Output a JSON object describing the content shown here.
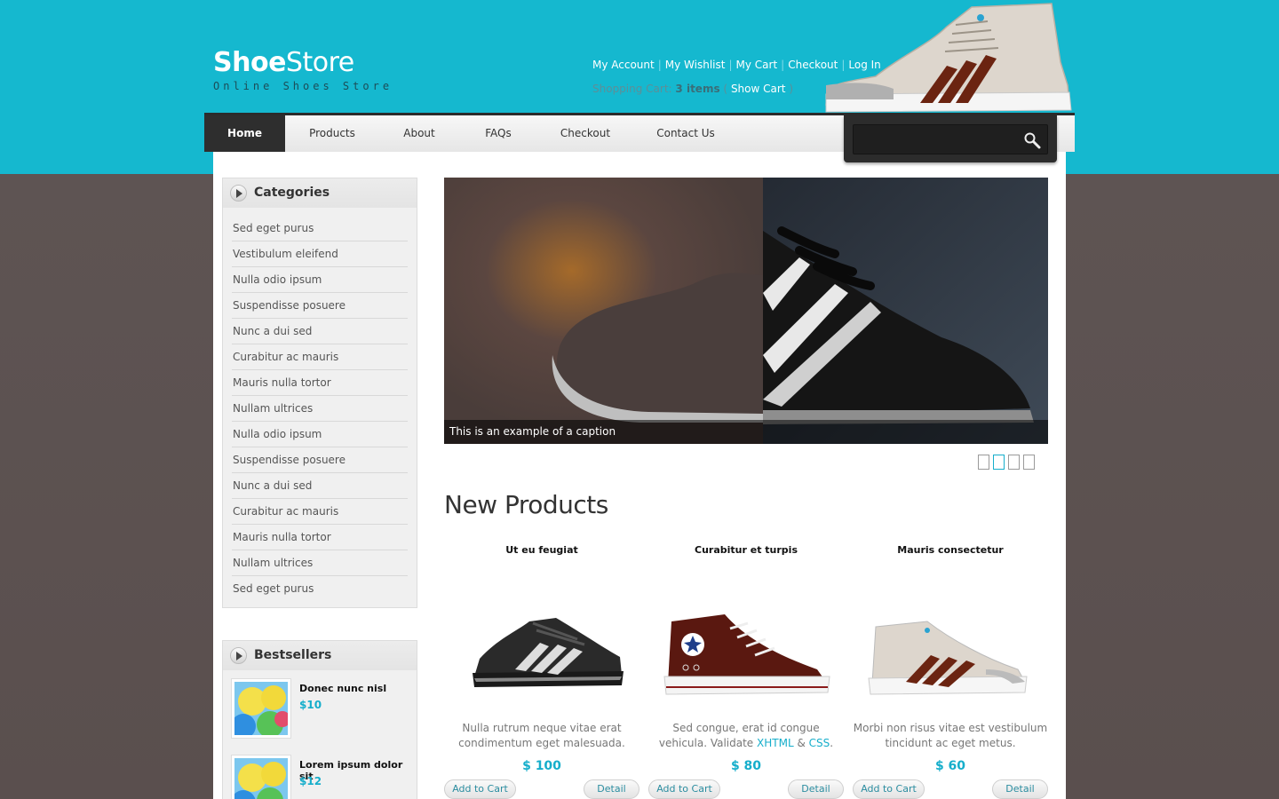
{
  "brand": {
    "name_bold": "Shoe",
    "name_light": "Store",
    "tagline": "Online Shoes Store"
  },
  "top_links": {
    "account": "My Account",
    "wishlist": "My Wishlist",
    "cart": "My Cart",
    "checkout": "Checkout",
    "login": "Log In",
    "separator": "|"
  },
  "cart_summary": {
    "label": "Shopping Cart:",
    "items": "3 items",
    "open_paren": "(",
    "show_cart": "Show Cart",
    "close_paren": ")"
  },
  "nav": {
    "items": [
      {
        "label": "Home",
        "active": true
      },
      {
        "label": "Products"
      },
      {
        "label": "About"
      },
      {
        "label": "FAQs"
      },
      {
        "label": "Checkout"
      },
      {
        "label": "Contact Us"
      }
    ]
  },
  "search": {
    "placeholder": ""
  },
  "sidebar": {
    "categories_title": "Categories",
    "categories": [
      "Sed eget purus",
      "Vestibulum eleifend",
      "Nulla odio ipsum",
      "Suspendisse posuere",
      "Nunc a dui sed",
      "Curabitur ac mauris",
      "Mauris nulla tortor",
      "Nullam ultrices",
      "Nulla odio ipsum",
      "Suspendisse posuere",
      "Nunc a dui sed",
      "Curabitur ac mauris",
      "Mauris nulla tortor",
      "Nullam ultrices",
      "Sed eget purus"
    ],
    "bestsellers_title": "Bestsellers",
    "bestsellers": [
      {
        "name": "Donec nunc nisl",
        "price": "$10"
      },
      {
        "name": "Lorem ipsum dolor sit",
        "price": "$12"
      }
    ]
  },
  "slider": {
    "caption": "This is an example of a caption",
    "slide_count": 4,
    "active_slide": 2
  },
  "new_products": {
    "title": "New Products",
    "items": [
      {
        "name": "Ut eu feugiat",
        "desc": "Nulla rutrum neque vitae erat condimentum eget malesuada.",
        "price": "$ 100"
      },
      {
        "name": "Curabitur et turpis",
        "desc_pre": "Sed congue, erat id congue vehicula. Validate ",
        "link1": "XHTML",
        "amp": " & ",
        "link2": "CSS",
        "desc_post": ".",
        "price": "$ 80"
      },
      {
        "name": "Mauris consectetur",
        "desc": "Morbi non risus vitae est vestibulum tincidunt ac eget metus.",
        "price": "$ 60"
      }
    ],
    "add_to_cart": "Add to Cart",
    "detail": "Detail"
  },
  "colors": {
    "accent": "#16aecb",
    "header_band": "#15b8cf",
    "nav_dark": "#2e2e2e",
    "background": "#5a4f4e"
  }
}
